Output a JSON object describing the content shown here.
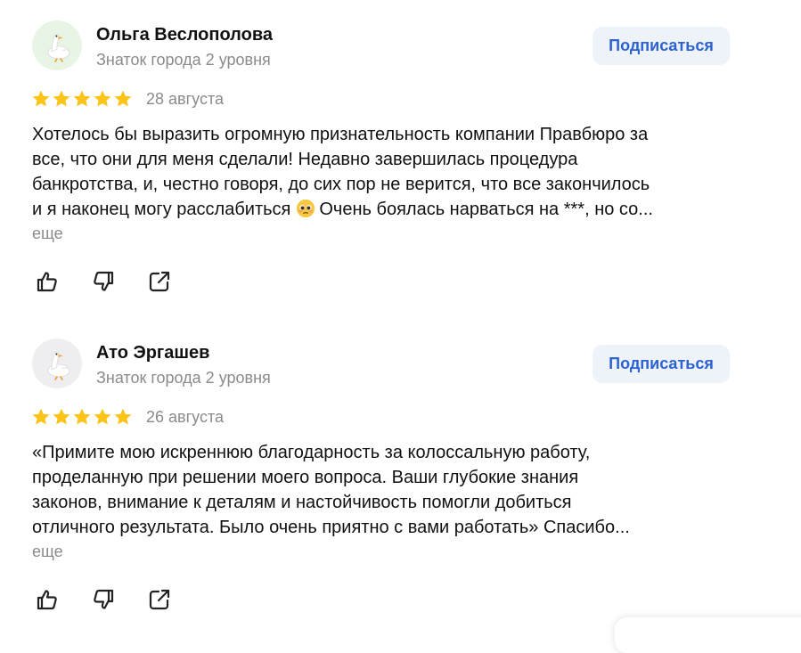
{
  "reviews": [
    {
      "author": "Ольга Веслополова",
      "level": "Знаток города 2 уровня",
      "subscribe_label": "Подписаться",
      "rating": 5,
      "date": "28 августа",
      "text_lines": [
        "Хотелось бы выразить огромную признательность компании Правбюро за",
        "все, что они для меня сделали! Недавно завершилась процедура",
        "банкротства, и, честно говоря, до сих пор не верится, что все закончилось",
        "и я наконец могу расслабиться",
        "Очень боялась нарваться на ***, но со..."
      ],
      "more_label": "еще",
      "avatar_icon": "goose-avatar-icon",
      "avatar_bg": "#e8f5e4"
    },
    {
      "author": "Ато Эргашев",
      "level": "Знаток города 2 уровня",
      "subscribe_label": "Подписаться",
      "rating": 5,
      "date": "26 августа",
      "text_lines": [
        "«Примите мою искреннюю благодарность за колоссальную работу,",
        "проделанную при решении моего вопроса. Ваши глубокие знания",
        "законов, внимание к деталям и настойчивость помогли добиться",
        "отличного результата. Было очень приятно с вами работать» Спасибо..."
      ],
      "more_label": "еще",
      "avatar_icon": "goose-avatar-icon",
      "avatar_bg": "#eeeef0"
    }
  ],
  "icons": {
    "star": "star-icon",
    "like": "thumbs-up-icon",
    "dislike": "thumbs-down-icon",
    "share": "share-icon",
    "emoji": "pleading-face-emoji"
  },
  "colors": {
    "star": "#fcc419",
    "link_blue": "#2d62d3",
    "button_bg": "#eef3fa",
    "muted_text": "#8a8a8a"
  }
}
